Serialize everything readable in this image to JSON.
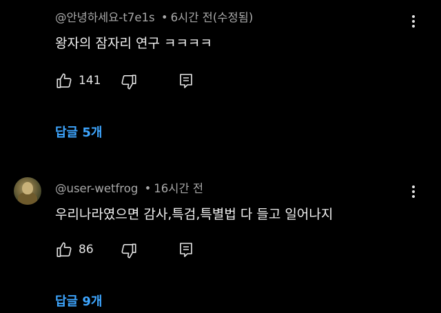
{
  "comments": [
    {
      "author": "@안녕하세요-t7e1s",
      "separator": "•",
      "time": "6시간 전(수정됨)",
      "text": "왕자의 잠자리 연구 ㅋㅋㅋㅋ",
      "likes": "141",
      "replies_label": "답글 5개",
      "has_avatar": false
    },
    {
      "author": "@user-wetfrog",
      "separator": "•",
      "time": "16시간 전",
      "text": "우리나라였으면 감사,특검,특별법 다 들고 일어나지",
      "likes": "86",
      "replies_label": "답글 9개",
      "has_avatar": true
    }
  ],
  "icons": {
    "like": "thumbs-up-icon",
    "dislike": "thumbs-down-icon",
    "reply": "reply-icon",
    "menu": "more-vertical-icon"
  },
  "colors": {
    "background": "#000000",
    "meta_text": "#aaaaaa",
    "body_text": "#f1f1f1",
    "link": "#3ea6ff"
  }
}
